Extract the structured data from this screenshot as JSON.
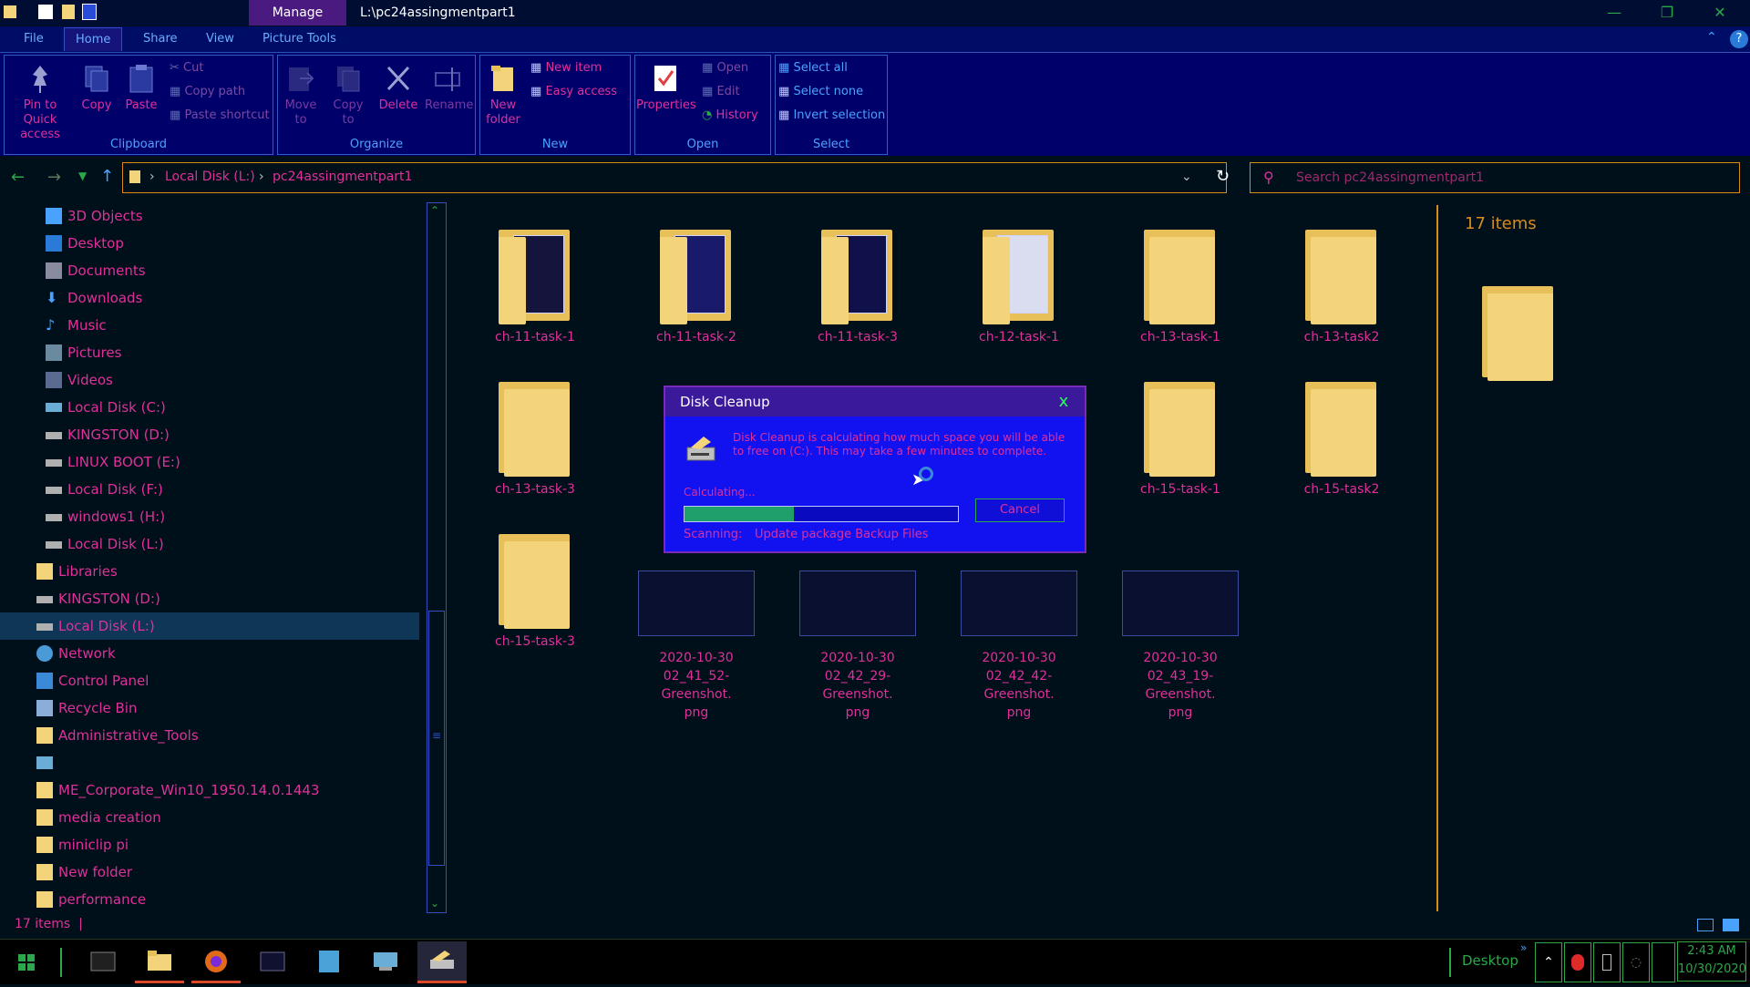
{
  "titlebar": {
    "manage": "Manage",
    "path": "L:\\pc24assingmentpart1"
  },
  "menu": {
    "tabs": [
      "File",
      "Home",
      "Share",
      "View",
      "Picture Tools"
    ]
  },
  "ribbon": {
    "clipboard": {
      "pin": "Pin to Quick access",
      "copy": "Copy",
      "paste": "Paste",
      "cut": "Cut",
      "copy_path": "Copy path",
      "paste_shortcut": "Paste shortcut",
      "label": "Clipboard"
    },
    "organize": {
      "move_to": "Move to",
      "copy_to": "Copy to",
      "delete": "Delete",
      "rename": "Rename",
      "label": "Organize"
    },
    "new": {
      "new_folder": "New folder",
      "new_item": "New item",
      "easy_access": "Easy access",
      "label": "New"
    },
    "open": {
      "properties": "Properties",
      "open": "Open",
      "edit": "Edit",
      "history": "History",
      "label": "Open"
    },
    "select": {
      "select_all": "Select all",
      "select_none": "Select none",
      "invert": "Invert selection",
      "label": "Select"
    }
  },
  "address": {
    "crumb1": "Local Disk (L:)",
    "crumb2": "pc24assingmentpart1",
    "search_placeholder": "Search pc24assingmentpart1"
  },
  "sidebar": {
    "items": [
      {
        "label": "3D Objects"
      },
      {
        "label": "Desktop"
      },
      {
        "label": "Documents"
      },
      {
        "label": "Downloads"
      },
      {
        "label": "Music"
      },
      {
        "label": "Pictures"
      },
      {
        "label": "Videos"
      },
      {
        "label": "Local Disk (C:)"
      },
      {
        "label": "KINGSTON (D:)"
      },
      {
        "label": "LINUX BOOT (E:)"
      },
      {
        "label": "Local Disk (F:)"
      },
      {
        "label": "windows1 (H:)"
      },
      {
        "label": "Local Disk (L:)"
      },
      {
        "label": "Libraries"
      },
      {
        "label": "KINGSTON (D:)"
      },
      {
        "label": "Local Disk (L:)"
      },
      {
        "label": "Network"
      },
      {
        "label": "Control Panel"
      },
      {
        "label": "Recycle Bin"
      },
      {
        "label": "Administrative_Tools"
      },
      {
        "label": ""
      },
      {
        "label": "ME_Corporate_Win10_1950.14.0.1443"
      },
      {
        "label": "media creation"
      },
      {
        "label": "miniclip pi"
      },
      {
        "label": "New folder"
      },
      {
        "label": "performance"
      }
    ]
  },
  "files": {
    "row1": [
      "ch-11-task-1",
      "ch-11-task-2",
      "ch-11-task-3",
      "ch-12-task-1",
      "ch-13-task-1",
      "ch-13-task2"
    ],
    "row2": [
      "ch-13-task-3",
      "ch-15-task-1",
      "ch-15-task2"
    ],
    "row3_folder": "ch-15-task-3",
    "images": [
      {
        "l1": "2020-10-30",
        "l2": "02_41_52-Greenshot.",
        "l3": "png"
      },
      {
        "l1": "2020-10-30",
        "l2": "02_42_29-Greenshot.",
        "l3": "png"
      },
      {
        "l1": "2020-10-30",
        "l2": "02_42_42-Greenshot.",
        "l3": "png"
      },
      {
        "l1": "2020-10-30",
        "l2": "02_43_19-Greenshot.",
        "l3": "png"
      }
    ]
  },
  "preview": {
    "count": "17 items"
  },
  "dialog": {
    "title": "Disk Cleanup",
    "close": "x",
    "message": "Disk Cleanup is calculating how much space you will be able to free on (C:). This may take a few minutes to complete.",
    "calculating": "Calculating...",
    "progress": 0.4,
    "cancel": "Cancel",
    "scanning_label": "Scanning:",
    "scanning_value": "Update package Backup Files"
  },
  "status": {
    "count": "17 items",
    "sep": "|"
  },
  "taskbar": {
    "desktop": "Desktop",
    "time": "2:43 AM",
    "date": "10/30/2020"
  },
  "colors": {
    "accent_pink": "#e0309a",
    "accent_orange": "#d98c1a",
    "accent_green": "#2aa84a",
    "ribbon_bg": "#00006a",
    "folder": "#f4d47a"
  }
}
